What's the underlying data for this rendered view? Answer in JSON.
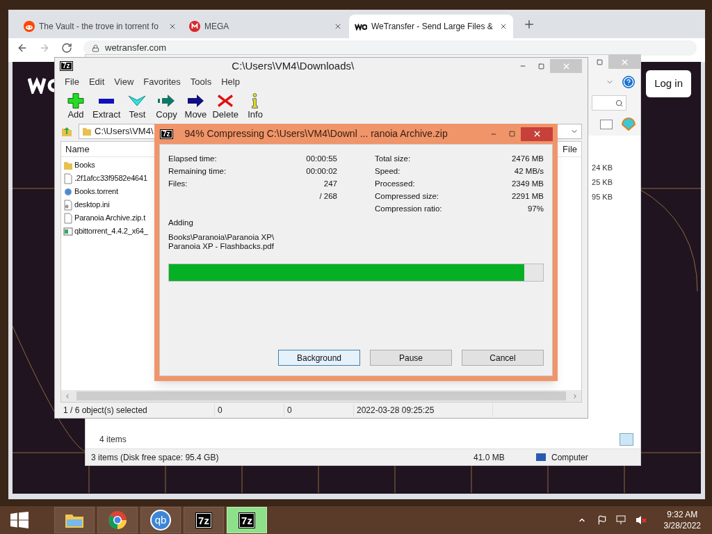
{
  "browser": {
    "tabs": [
      {
        "title": "The Vault - the trove in torrent fo",
        "kind": "reddit",
        "selected": false
      },
      {
        "title": "MEGA",
        "kind": "mega",
        "selected": false
      },
      {
        "title": "WeTransfer - Send Large Files &",
        "kind": "we",
        "selected": true
      }
    ],
    "url": "wetransfer.com",
    "login": "Log in"
  },
  "explorer": {
    "sizes": [
      "24 KB",
      "25 KB",
      "95 KB"
    ],
    "item_count": "4 items",
    "status": "3 items (Disk free space: 95.4 GB)",
    "status_size": "41.0 MB",
    "status_location": "Computer"
  },
  "sevenzip": {
    "app_icon": "7z",
    "title": "C:\\Users\\VM4\\Downloads\\",
    "menu": [
      "File",
      "Edit",
      "View",
      "Favorites",
      "Tools",
      "Help"
    ],
    "toolbar": [
      {
        "label": "Add",
        "kind": "add"
      },
      {
        "label": "Extract",
        "kind": "extract"
      },
      {
        "label": "Test",
        "kind": "test"
      },
      {
        "label": "Copy",
        "kind": "copy"
      },
      {
        "label": "Move",
        "kind": "move"
      },
      {
        "label": "Delete",
        "kind": "delete"
      },
      {
        "label": "Info",
        "kind": "info"
      }
    ],
    "path": "C:\\Users\\VM4\\",
    "columns": [
      "Name",
      "File"
    ],
    "files": [
      {
        "name": "Books",
        "kind": "folder"
      },
      {
        "name": ".2f1afcc33f9582e4641",
        "kind": "file"
      },
      {
        "name": "Books.torrent",
        "kind": "torrent"
      },
      {
        "name": "desktop.ini",
        "kind": "settings"
      },
      {
        "name": "Paranoia Archive.zip.t",
        "kind": "file"
      },
      {
        "name": "qbittorrent_4.4.2_x64_",
        "kind": "app"
      }
    ],
    "status": [
      "1 / 6 object(s) selected",
      "0",
      "0",
      "2022-03-28 09:25:25"
    ]
  },
  "dialog": {
    "app_icon": "7z",
    "title": "94% Compressing C:\\Users\\VM4\\Downl ... ranoia Archive.zip",
    "left": [
      {
        "label": "Elapsed time:",
        "value": "00:00:55"
      },
      {
        "label": "Remaining time:",
        "value": "00:00:02"
      },
      {
        "label": "Files:",
        "value": "247"
      },
      {
        "value": "/ 268"
      }
    ],
    "right": [
      {
        "label": "Total size:",
        "value": "2476 MB"
      },
      {
        "label": "Speed:",
        "value": "42 MB/s"
      },
      {
        "label": "Processed:",
        "value": "2349 MB"
      },
      {
        "label": "Compressed size:",
        "value": "2291 MB"
      },
      {
        "label": "Compression ratio:",
        "value": "97%"
      }
    ],
    "action": "Adding",
    "current_file": [
      "Books\\Paranoia\\Paranoia XP\\",
      "Paranoia XP - Flashbacks.pdf"
    ],
    "level": 0.95,
    "buttons": [
      {
        "label": "Background",
        "focused": true
      },
      {
        "label": "Pause",
        "focused": false
      },
      {
        "label": "Cancel",
        "focused": false
      }
    ]
  },
  "taskbar": {
    "apps": [
      {
        "kind": "explorer",
        "active": false
      },
      {
        "kind": "chrome",
        "active": false
      },
      {
        "kind": "torrent",
        "label": "qb",
        "active": false
      },
      {
        "kind": "archiver",
        "label": "7z",
        "active": false
      },
      {
        "kind": "archiver",
        "label": "7z",
        "active": true
      }
    ],
    "time": "9:32 AM",
    "date": "3/28/2022"
  }
}
